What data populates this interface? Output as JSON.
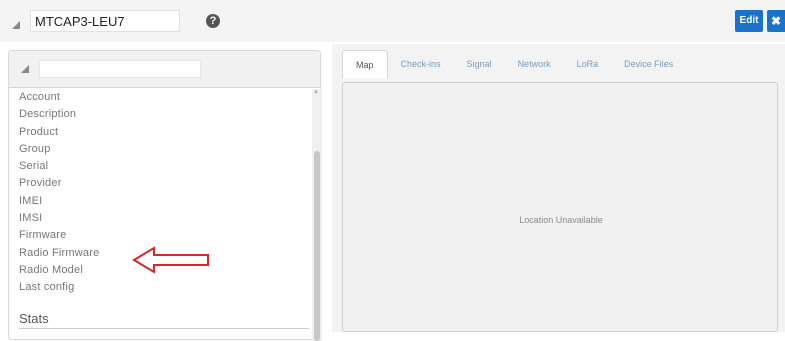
{
  "header": {
    "device_name": "MTCAP3-LEU7",
    "help_icon": "question-circle-icon",
    "edit_label": "Edit",
    "close_label": "✖",
    "accent_color": "#1a73c9"
  },
  "sidebar": {
    "fields": [
      "Account",
      "Description",
      "Product",
      "Group",
      "Serial",
      "Provider",
      "IMEI",
      "IMSI",
      "Firmware",
      "Radio Firmware",
      "Radio Model",
      "Last config"
    ],
    "section_title": "Stats",
    "annotation_color": "#d9262b"
  },
  "tabs": [
    "Map",
    "Check-ins",
    "Signal",
    "Network",
    "LoRa",
    "Device Files"
  ],
  "active_tab": "Map",
  "map": {
    "message": "Location Unavailable"
  }
}
